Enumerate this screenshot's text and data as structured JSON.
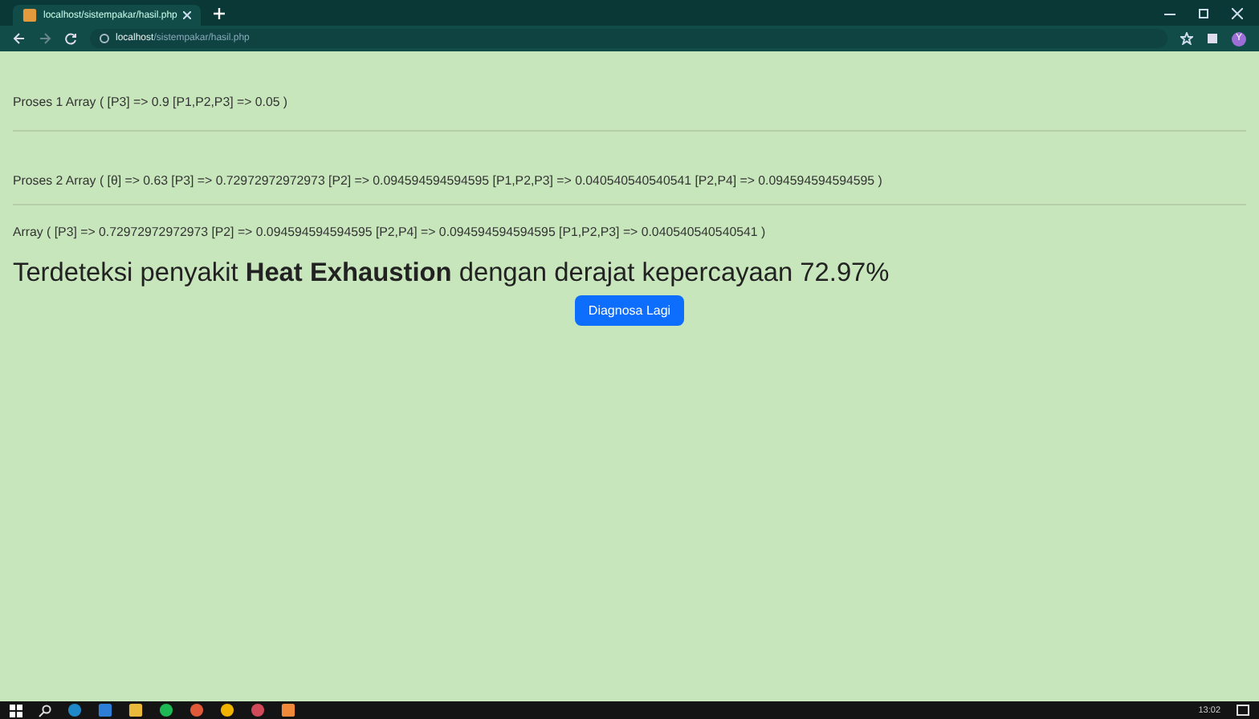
{
  "browser": {
    "tab": {
      "title": "localhost/sistempakar/hasil.php",
      "selected": true
    },
    "address": {
      "host": "localhost",
      "path": "/sistempakar/hasil.php"
    },
    "profile": "Y"
  },
  "lines": [
    "Proses 1 Array ( [P3] => 0.9 [P1,P2,P3] => 0.05 )",
    "Proses 2 Array ( [θ] => 0.63 [P3] => 0.72972972972973 [P2] => 0.094594594594595 [P1,P2,P3] => 0.040540540540541 [P2,P4] => 0.094594594594595 )",
    "Array ( [P3] => 0.72972972972973 [P2] => 0.094594594594595 [P2,P4] => 0.094594594594595 [P1,P2,P3] => 0.040540540540541 )"
  ],
  "result": "Terdeteksi penyakit **Heat Exhaustion** dengan derajat kepercayaan 72.97%",
  "button": "Diagnosa Lagi",
  "taskbar": {
    "time": "13:02"
  }
}
